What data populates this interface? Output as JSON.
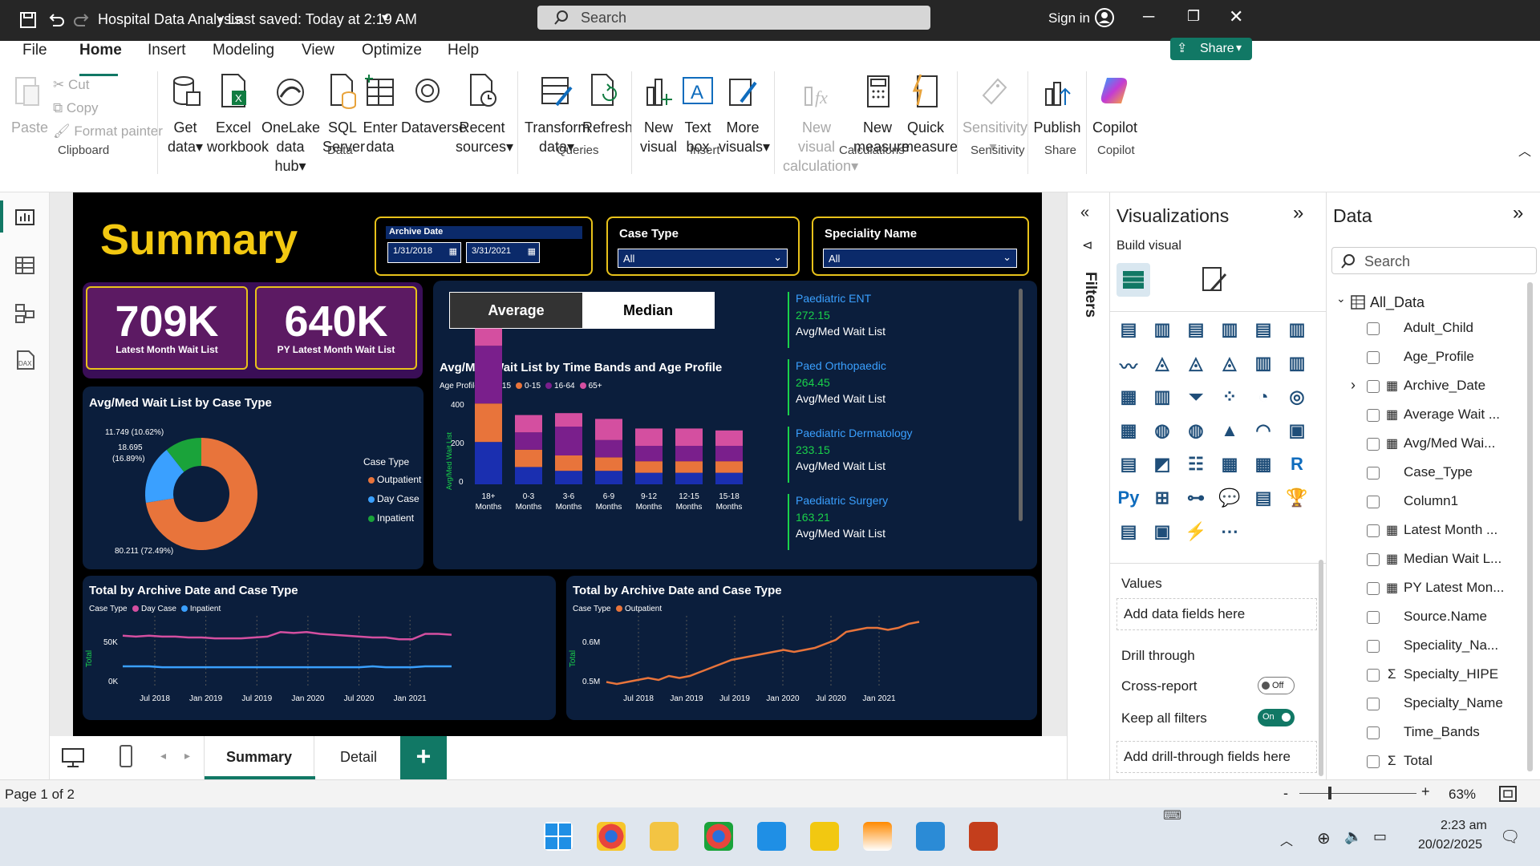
{
  "window": {
    "title": "Hospital Data Analysis",
    "saved": "Last saved: Today at 2:19 AM",
    "search_placeholder": "Search",
    "sign_in": "Sign in"
  },
  "menu": {
    "tabs": [
      "File",
      "Home",
      "Insert",
      "Modeling",
      "View",
      "Optimize",
      "Help"
    ],
    "share": "Share"
  },
  "ribbon": {
    "clipboard": {
      "paste": "Paste",
      "cut": "Cut",
      "copy": "Copy",
      "format_painter": "Format painter",
      "group": "Clipboard"
    },
    "data": {
      "get_data": [
        "Get",
        "data"
      ],
      "excel": [
        "Excel",
        "workbook"
      ],
      "onelake": [
        "OneLake",
        "data hub"
      ],
      "sql": [
        "SQL",
        "Server"
      ],
      "enter": [
        "Enter",
        "data"
      ],
      "dataverse": "Dataverse",
      "recent": [
        "Recent",
        "sources"
      ],
      "group": "Data"
    },
    "queries": {
      "transform": [
        "Transform",
        "data"
      ],
      "refresh": "Refresh",
      "group": "Queries"
    },
    "insert": {
      "new_visual": [
        "New",
        "visual"
      ],
      "text_box": [
        "Text",
        "box"
      ],
      "more": [
        "More",
        "visuals"
      ],
      "group": "Insert"
    },
    "calculations": {
      "new_visual_calc": [
        "New visual",
        "calculation"
      ],
      "new_measure": [
        "New",
        "measure"
      ],
      "quick_measure": [
        "Quick",
        "measure"
      ],
      "group": "Calculations"
    },
    "sensitivity": {
      "label": "Sensitivity",
      "group": "Sensitivity"
    },
    "share": {
      "publish": "Publish",
      "group": "Share"
    },
    "copilot": {
      "label": "Copilot",
      "group": "Copilot"
    }
  },
  "report": {
    "title": "Summary",
    "archive_date": {
      "label": "Archive Date",
      "from": "1/31/2018",
      "to": "3/31/2021"
    },
    "case_type": {
      "label": "Case Type",
      "value": "All"
    },
    "speciality": {
      "label": "Speciality Name",
      "value": "All"
    },
    "kpi1": {
      "value": "709K",
      "label": "Latest Month Wait List"
    },
    "kpi2": {
      "value": "640K",
      "label": "PY Latest Month Wait List"
    },
    "toggle": {
      "average": "Average",
      "median": "Median"
    },
    "specialties": [
      {
        "name": "Paediatric ENT",
        "value": "272.15",
        "label": "Avg/Med Wait List"
      },
      {
        "name": "Paed Orthopaedic",
        "value": "264.45",
        "label": "Avg/Med Wait List"
      },
      {
        "name": "Paediatric Dermatology",
        "value": "233.15",
        "label": "Avg/Med Wait List"
      },
      {
        "name": "Paediatric Surgery",
        "value": "163.21",
        "label": "Avg/Med Wait List"
      }
    ],
    "donut_title": "Avg/Med Wait List by Case Type",
    "donut_legend_title": "Case Type",
    "donut_labels": [
      "11.749 (10.62%)",
      "18.695",
      "(16.89%)",
      "80.211 (72.49%)"
    ],
    "bar_title": "Avg/Med Wait List by Time Bands and Age Profile",
    "bar_legend_title": "Age Profile",
    "bar_ylabel": "Avg/Med Wait List",
    "bar_yticks": [
      "400",
      "200",
      "0"
    ],
    "line1_title": "Total by Archive Date and Case Type",
    "line1_legend_title": "Case Type",
    "line1_yticks": [
      "50K",
      "0K"
    ],
    "line2_title": "Total by Archive Date and Case Type",
    "line2_legend_title": "Case Type",
    "line2_yticks": [
      "0.6M",
      "0.5M"
    ],
    "line_ylabel": "Total",
    "line1_xticks": [
      "Jul 2018",
      "Jan 2019",
      "Jul 2019",
      "Jan 2020",
      "Jul 2020",
      "Jan 2021"
    ],
    "line2_xticks": [
      "Jul 2018",
      "Jan 2019",
      "Jul 2019",
      "Jan 2020",
      "Jul 2020",
      "Jan 2021"
    ]
  },
  "chart_data": [
    {
      "type": "pie",
      "title": "Avg/Med Wait List by Case Type",
      "categories": [
        "Outpatient",
        "Day Case",
        "Inpatient"
      ],
      "values": [
        80.211,
        18.695,
        11.749
      ],
      "colors": [
        "#e8743b",
        "#3aa0ff",
        "#1aa33a"
      ]
    },
    {
      "type": "bar",
      "title": "Avg/Med Wait List by Time Bands and Age Profile",
      "categories": [
        "18+ Months",
        "0-3 Months",
        "3-6 Months",
        "6-9 Months",
        "9-12 Months",
        "12-15 Months",
        "15-18 Months"
      ],
      "series": [
        {
          "name": "0-15",
          "values": [
            110,
            45,
            35,
            35,
            30,
            30,
            30
          ]
        },
        {
          "name": "0-15",
          "values": [
            100,
            45,
            40,
            35,
            30,
            30,
            30
          ]
        },
        {
          "name": "16-64",
          "values": [
            150,
            45,
            75,
            45,
            40,
            40,
            40
          ]
        },
        {
          "name": "65+",
          "values": [
            45,
            45,
            35,
            55,
            45,
            45,
            40
          ]
        }
      ],
      "colors": [
        "#1a2fb0",
        "#e8743b",
        "#7a1f8c",
        "#d44fa0"
      ],
      "ylim": [
        0,
        420
      ],
      "ylabel": "Avg/Med Wait List"
    },
    {
      "type": "line",
      "title": "Total by Archive Date and Case Type",
      "series": [
        {
          "name": "Day Case",
          "values": [
            58,
            57,
            58,
            57,
            57,
            56,
            56,
            55,
            55,
            55,
            56,
            57,
            62,
            61,
            62,
            60,
            59,
            58,
            57,
            56,
            56,
            54,
            54,
            60,
            60,
            59
          ]
        },
        {
          "name": "Inpatient",
          "values": [
            24,
            24,
            24,
            23,
            23,
            23,
            23,
            23,
            23,
            23,
            23,
            23,
            23,
            23,
            23,
            23,
            23,
            23,
            23,
            24,
            23,
            23,
            23,
            24,
            24,
            24
          ]
        }
      ],
      "colors": [
        "#d44fa0",
        "#3aa0ff"
      ],
      "ylim": [
        0,
        80
      ],
      "yticks": [
        "50K",
        "0K"
      ]
    },
    {
      "type": "line",
      "title": "Total by Archive Date and Case Type",
      "series": [
        {
          "name": "Outpatient",
          "values": [
            0.505,
            0.5,
            0.505,
            0.51,
            0.515,
            0.51,
            0.52,
            0.515,
            0.52,
            0.53,
            0.54,
            0.55,
            0.56,
            0.565,
            0.57,
            0.575,
            0.58,
            0.585,
            0.58,
            0.585,
            0.59,
            0.6,
            0.61,
            0.63,
            0.635,
            0.64,
            0.64,
            0.635,
            0.64,
            0.65,
            0.655
          ]
        }
      ],
      "colors": [
        "#e8743b"
      ],
      "ylim": [
        0.49,
        0.67
      ]
    }
  ],
  "filters": {
    "label": "Filters"
  },
  "viz": {
    "title": "Visualizations",
    "build": "Build visual",
    "values": "Values",
    "values_hint": "Add data fields here",
    "drill": "Drill through",
    "cross_report": "Cross-report",
    "cross_state": "Off",
    "keep_filters": "Keep all filters",
    "keep_state": "On",
    "drill_hint": "Add drill-through fields here"
  },
  "data_pane": {
    "title": "Data",
    "search_placeholder": "Search",
    "table": "All_Data",
    "fields": [
      "Adult_Child",
      "Age_Profile",
      "Archive_Date",
      "Average Wait ...",
      "Avg/Med Wai...",
      "Case_Type",
      "Column1",
      "Latest Month ...",
      "Median Wait L...",
      "PY Latest Mon...",
      "Source.Name",
      "Speciality_Na...",
      "Specialty_HIPE",
      "Specialty_Name",
      "Time_Bands",
      "Total"
    ]
  },
  "pages": {
    "tabs": [
      "Summary",
      "Detail"
    ],
    "add": "+"
  },
  "status": {
    "page": "Page 1 of 2",
    "zoom": "63%"
  },
  "taskbar": {
    "time": "2:23 am",
    "date": "20/02/2025"
  }
}
